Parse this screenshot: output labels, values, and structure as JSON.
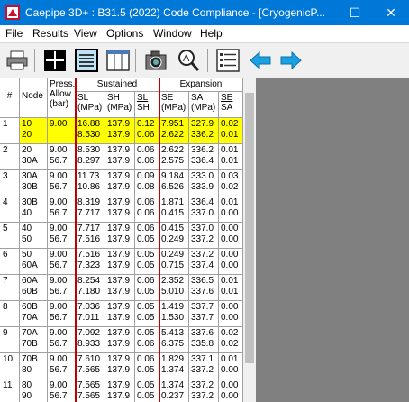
{
  "window": {
    "title": "Caepipe 3D+ : B31.5 (2022) Code Compliance - [CryogenicP...",
    "minimize_glyph": "—",
    "maximize_glyph": "☐",
    "close_glyph": "✕"
  },
  "menu": [
    "File",
    "Results",
    "View",
    "Options",
    "Window",
    "Help"
  ],
  "toolbar_icons": [
    "printer-icon",
    "grid-icon",
    "document-icon",
    "columns-icon",
    "camera-icon",
    "zoom-icon",
    "list-icon",
    "arrow-left-icon",
    "arrow-right-icon"
  ],
  "colors": {
    "titlebar": "#0078d7",
    "highlight": "#ffff00",
    "redline": "#c00000",
    "arrow": "#1ba1e2"
  },
  "table": {
    "headers": {
      "rownum": "#",
      "node": "Node",
      "press_allow": [
        "Press.",
        "Allow.",
        "(bar)"
      ],
      "sustained": "Sustained",
      "expansion": "Expansion",
      "sl": [
        "SL",
        "(MPa)"
      ],
      "sh": [
        "SH",
        "(MPa)"
      ],
      "sl_sh": [
        "SL",
        "SH"
      ],
      "se": [
        "SE",
        "(MPa)"
      ],
      "sa": [
        "SA",
        "(MPa)"
      ],
      "se_sa": [
        "SE",
        "SA"
      ]
    },
    "rows": [
      {
        "n": "1",
        "node": [
          "10",
          "20"
        ],
        "press": [
          "9.00",
          ""
        ],
        "sl": [
          "16.88",
          "8.530"
        ],
        "sh": [
          "137.9",
          "137.9"
        ],
        "slsh": [
          "0.12",
          "0.06"
        ],
        "se": [
          "7.951",
          "2.622"
        ],
        "sa": [
          "327.9",
          "336.2"
        ],
        "sesa": [
          "0.02",
          "0.01"
        ],
        "highlight": true
      },
      {
        "n": "2",
        "node": [
          "20",
          "30A"
        ],
        "press": [
          "9.00",
          "56.7"
        ],
        "sl": [
          "8.530",
          "8.297"
        ],
        "sh": [
          "137.9",
          "137.9"
        ],
        "slsh": [
          "0.06",
          "0.06"
        ],
        "se": [
          "2.622",
          "2.575"
        ],
        "sa": [
          "336.2",
          "336.4"
        ],
        "sesa": [
          "0.01",
          "0.01"
        ]
      },
      {
        "n": "3",
        "node": [
          "30A",
          "30B"
        ],
        "press": [
          "9.00",
          "56.7"
        ],
        "sl": [
          "11.73",
          "10.86"
        ],
        "sh": [
          "137.9",
          "137.9"
        ],
        "slsh": [
          "0.09",
          "0.08"
        ],
        "se": [
          "9.184",
          "6.526"
        ],
        "sa": [
          "333.0",
          "333.9"
        ],
        "sesa": [
          "0.03",
          "0.02"
        ]
      },
      {
        "n": "4",
        "node": [
          "30B",
          "40"
        ],
        "press": [
          "9.00",
          "56.7"
        ],
        "sl": [
          "8.319",
          "7.717"
        ],
        "sh": [
          "137.9",
          "137.9"
        ],
        "slsh": [
          "0.06",
          "0.06"
        ],
        "se": [
          "1.871",
          "0.415"
        ],
        "sa": [
          "336.4",
          "337.0"
        ],
        "sesa": [
          "0.01",
          "0.00"
        ]
      },
      {
        "n": "5",
        "node": [
          "40",
          "50"
        ],
        "press": [
          "9.00",
          "56.7"
        ],
        "sl": [
          "7.717",
          "7.516"
        ],
        "sh": [
          "137.9",
          "137.9"
        ],
        "slsh": [
          "0.06",
          "0.05"
        ],
        "se": [
          "0.415",
          "0.249"
        ],
        "sa": [
          "337.0",
          "337.2"
        ],
        "sesa": [
          "0.00",
          "0.00"
        ]
      },
      {
        "n": "6",
        "node": [
          "50",
          "60A"
        ],
        "press": [
          "9.00",
          "56.7"
        ],
        "sl": [
          "7.516",
          "7.323"
        ],
        "sh": [
          "137.9",
          "137.9"
        ],
        "slsh": [
          "0.05",
          "0.05"
        ],
        "se": [
          "0.249",
          "0.715"
        ],
        "sa": [
          "337.2",
          "337.4"
        ],
        "sesa": [
          "0.00",
          "0.00"
        ]
      },
      {
        "n": "7",
        "node": [
          "60A",
          "60B"
        ],
        "press": [
          "9.00",
          "56.7"
        ],
        "sl": [
          "8.254",
          "7.180"
        ],
        "sh": [
          "137.9",
          "137.9"
        ],
        "slsh": [
          "0.06",
          "0.05"
        ],
        "se": [
          "2.352",
          "5.010"
        ],
        "sa": [
          "336.5",
          "337.6"
        ],
        "sesa": [
          "0.01",
          "0.01"
        ]
      },
      {
        "n": "8",
        "node": [
          "60B",
          "70A"
        ],
        "press": [
          "9.00",
          "56.7"
        ],
        "sl": [
          "7.036",
          "7.011"
        ],
        "sh": [
          "137.9",
          "137.9"
        ],
        "slsh": [
          "0.05",
          "0.05"
        ],
        "se": [
          "1.419",
          "1.530"
        ],
        "sa": [
          "337.7",
          "337.7"
        ],
        "sesa": [
          "0.00",
          "0.00"
        ]
      },
      {
        "n": "9",
        "node": [
          "70A",
          "70B"
        ],
        "press": [
          "9.00",
          "56.7"
        ],
        "sl": [
          "7.092",
          "8.933"
        ],
        "sh": [
          "137.9",
          "137.9"
        ],
        "slsh": [
          "0.05",
          "0.06"
        ],
        "se": [
          "5.413",
          "6.375"
        ],
        "sa": [
          "337.6",
          "335.8"
        ],
        "sesa": [
          "0.02",
          "0.02"
        ]
      },
      {
        "n": "10",
        "node": [
          "70B",
          "80"
        ],
        "press": [
          "9.00",
          "56.7"
        ],
        "sl": [
          "7.610",
          "7.565"
        ],
        "sh": [
          "137.9",
          "137.9"
        ],
        "slsh": [
          "0.06",
          "0.05"
        ],
        "se": [
          "1.829",
          "1.374"
        ],
        "sa": [
          "337.1",
          "337.2"
        ],
        "sesa": [
          "0.01",
          "0.00"
        ]
      },
      {
        "n": "11",
        "node": [
          "80",
          "90"
        ],
        "press": [
          "9.00",
          "56.7"
        ],
        "sl": [
          "7.565",
          "7.565"
        ],
        "sh": [
          "137.9",
          "137.9"
        ],
        "slsh": [
          "0.05",
          "0.05"
        ],
        "se": [
          "1.374",
          "0.237"
        ],
        "sa": [
          "337.2",
          "337.2"
        ],
        "sesa": [
          "0.00",
          "0.00"
        ]
      }
    ]
  }
}
